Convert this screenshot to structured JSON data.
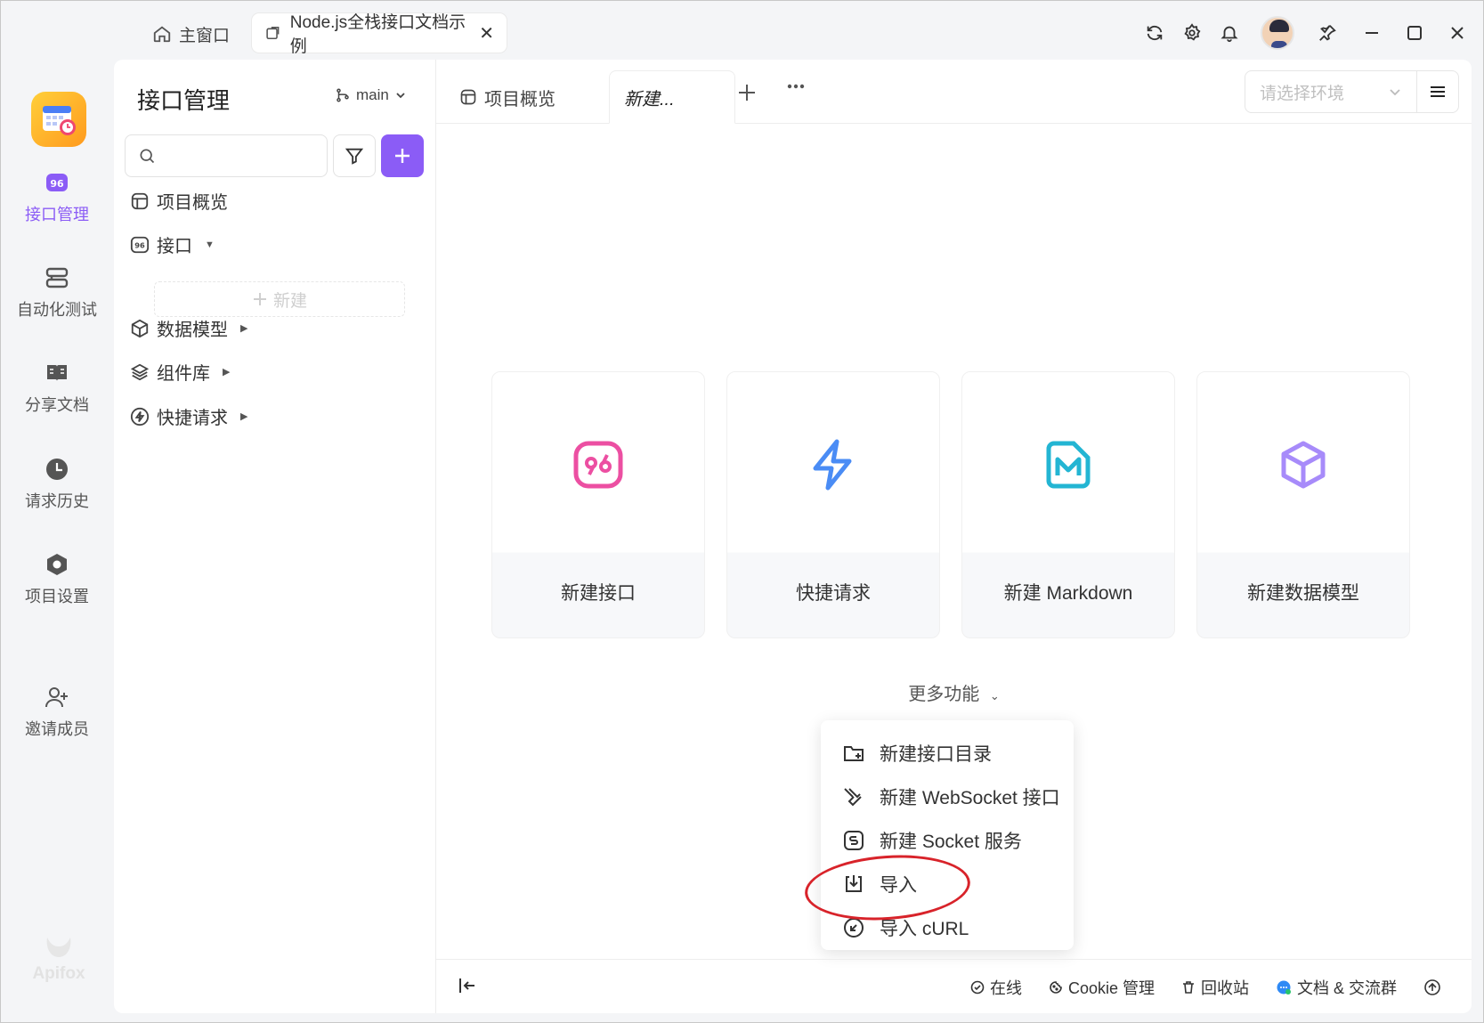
{
  "titlebar": {
    "home_tab": "主窗口",
    "doc_tab": "Node.js全栈接口文档示例",
    "close_glyph": "✕"
  },
  "leftnav": {
    "items": [
      {
        "label": "接口管理",
        "icon": "api-icon",
        "active": true
      },
      {
        "label": "自动化测试",
        "icon": "automation-icon",
        "active": false
      },
      {
        "label": "分享文档",
        "icon": "book-icon",
        "active": false
      },
      {
        "label": "请求历史",
        "icon": "clock-icon",
        "active": false
      },
      {
        "label": "项目设置",
        "icon": "settings-hex-icon",
        "active": false
      },
      {
        "label": "邀请成员",
        "icon": "add-user-icon",
        "active": false
      }
    ],
    "brand": "Apifox"
  },
  "panel": {
    "title": "接口管理",
    "branch": "main",
    "search_placeholder": "",
    "tree": [
      {
        "label": "项目概览",
        "icon": "overview-icon"
      },
      {
        "label": "接口",
        "icon": "api-icon"
      },
      {
        "label": "数据模型",
        "icon": "cube-icon"
      },
      {
        "label": "组件库",
        "icon": "layers-icon"
      },
      {
        "label": "快捷请求",
        "icon": "bolt-icon"
      }
    ],
    "new_label": "新建"
  },
  "main": {
    "tabs": [
      {
        "label": "项目概览"
      },
      {
        "label": "新建..."
      }
    ],
    "env_placeholder": "请选择环境",
    "cards": [
      {
        "label": "新建接口",
        "icon": "api-icon",
        "color": "#ec4fa2"
      },
      {
        "label": "快捷请求",
        "icon": "bolt-icon",
        "color": "#4a8cf5"
      },
      {
        "label": "新建 Markdown",
        "icon": "markdown-icon",
        "color": "#23b5d3"
      },
      {
        "label": "新建数据模型",
        "icon": "cube-icon",
        "color": "#a78bfa"
      }
    ],
    "more_label": "更多功能",
    "dropdown": [
      {
        "label": "新建接口目录",
        "icon": "folder-add-icon"
      },
      {
        "label": "新建 WebSocket 接口",
        "icon": "websocket-icon"
      },
      {
        "label": "新建 Socket 服务",
        "icon": "socket-icon"
      },
      {
        "label": "导入",
        "icon": "import-icon"
      },
      {
        "label": "导入 cURL",
        "icon": "curl-icon"
      }
    ]
  },
  "statusbar": {
    "online": "在线",
    "cookie": "Cookie 管理",
    "recycle": "回收站",
    "docs": "文档 & 交流群"
  },
  "colors": {
    "accent": "#8b5cf6",
    "annotation": "#d8232a"
  }
}
